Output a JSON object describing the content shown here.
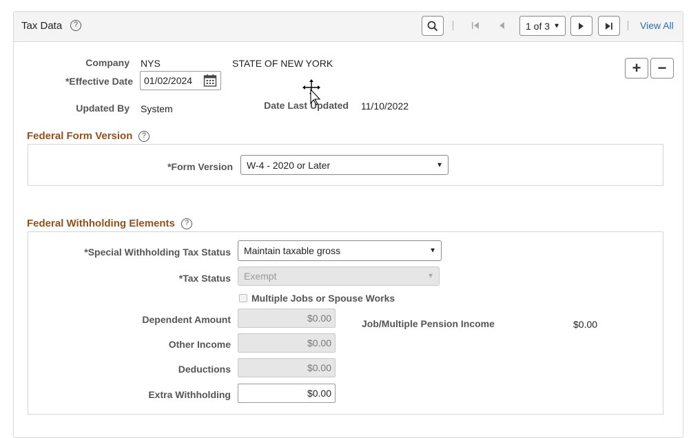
{
  "header": {
    "title": "Tax Data",
    "pagination": "1 of 3",
    "view_all": "View All"
  },
  "company": {
    "company_label": "Company",
    "company_code": "NYS",
    "company_name": "STATE OF NEW YORK",
    "effective_date_label": "*Effective Date",
    "effective_date": "01/02/2024",
    "updated_by_label": "Updated By",
    "updated_by": "System",
    "date_last_updated_label": "Date Last Updated",
    "date_last_updated": "11/10/2022"
  },
  "federal_form": {
    "section_title": "Federal Form Version",
    "form_version_label": "*Form Version",
    "form_version": "W-4 - 2020 or Later"
  },
  "withholding": {
    "section_title": "Federal Withholding Elements",
    "special_status_label": "*Special Withholding Tax Status",
    "special_status": "Maintain taxable gross",
    "tax_status_label": "*Tax Status",
    "tax_status": "Exempt",
    "multiple_jobs_label": "Multiple Jobs or Spouse Works",
    "dependent_amount_label": "Dependent Amount",
    "dependent_amount": "$0.00",
    "other_income_label": "Other Income",
    "other_income": "$0.00",
    "deductions_label": "Deductions",
    "deductions": "$0.00",
    "extra_withholding_label": "Extra Withholding",
    "extra_withholding": "$0.00",
    "job_pension_label": "Job/Multiple Pension Income",
    "job_pension": "$0.00"
  },
  "colors": {
    "section_title": "#94501a",
    "link": "#2a6eb5",
    "header_bg": "#f4f4f4"
  },
  "icons": [
    "help-icon",
    "search-icon",
    "first-page-icon",
    "previous-icon",
    "next-icon",
    "last-page-icon",
    "calendar-icon",
    "add-icon",
    "remove-icon",
    "move-cursor-icon",
    "pointer-cursor-icon"
  ]
}
